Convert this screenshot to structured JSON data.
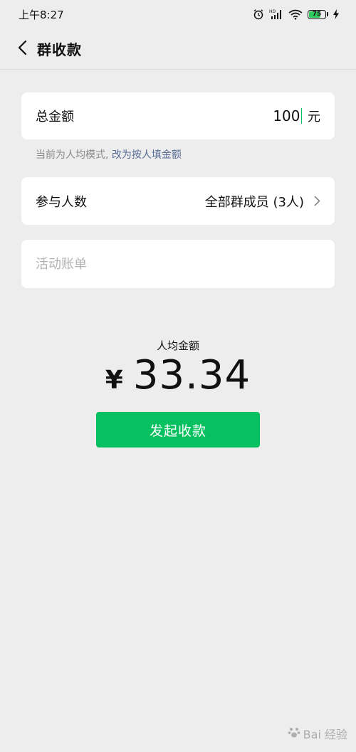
{
  "status_bar": {
    "time": "上午8:27",
    "battery_level": 75,
    "battery_text": "75",
    "icons": [
      "alarm-icon",
      "hd-signal-icon",
      "wifi-icon",
      "battery-icon",
      "charging-icon"
    ]
  },
  "nav": {
    "title": "群收款",
    "back_icon": "chevron-left-icon"
  },
  "total": {
    "label": "总金额",
    "value": "100",
    "unit": "元"
  },
  "mode_hint": {
    "text": "当前为人均模式, ",
    "link": "改为按人填金额"
  },
  "members": {
    "label": "参与人数",
    "value": "全部群成员 (3人)",
    "chevron_icon": "chevron-right-icon"
  },
  "bill": {
    "placeholder": "活动账单"
  },
  "per_person": {
    "label": "人均金额",
    "currency": "¥",
    "amount": "33.34"
  },
  "submit_label": "发起收款",
  "watermark": {
    "text": "Bai 经验"
  },
  "colors": {
    "background": "#ededed",
    "accent": "#07c160",
    "link": "#576b95",
    "battery": "#32c95c"
  }
}
